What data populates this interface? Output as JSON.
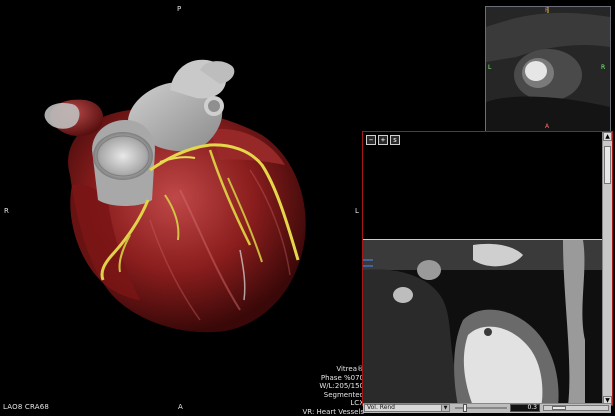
{
  "viewport": {
    "orientation": {
      "top": "P",
      "bottom": "A",
      "left": "R",
      "right": "L"
    },
    "view_angle": "LAO8 CRA68",
    "info": {
      "vendor": "Vitrea®",
      "phase": "Phase %070",
      "window_level": "W/L:205/150",
      "mode": "Segmented",
      "vessel": "LCX",
      "render_label": "VR: Heart Vessels"
    }
  },
  "inset": {
    "marker_top": "P",
    "marker_left": "L",
    "marker_right": "R",
    "marker_bottom": "A"
  },
  "mpr": {
    "toolbar": {
      "zoom_out": "−",
      "zoom_in": "+",
      "options": "s"
    },
    "render_mode": "Vol. Rend",
    "slab_value": "0.3"
  },
  "colors": {
    "myocardium": "#8c1f1f",
    "vessel_highlight": "#e5d74a",
    "panel_border": "#a41818"
  }
}
